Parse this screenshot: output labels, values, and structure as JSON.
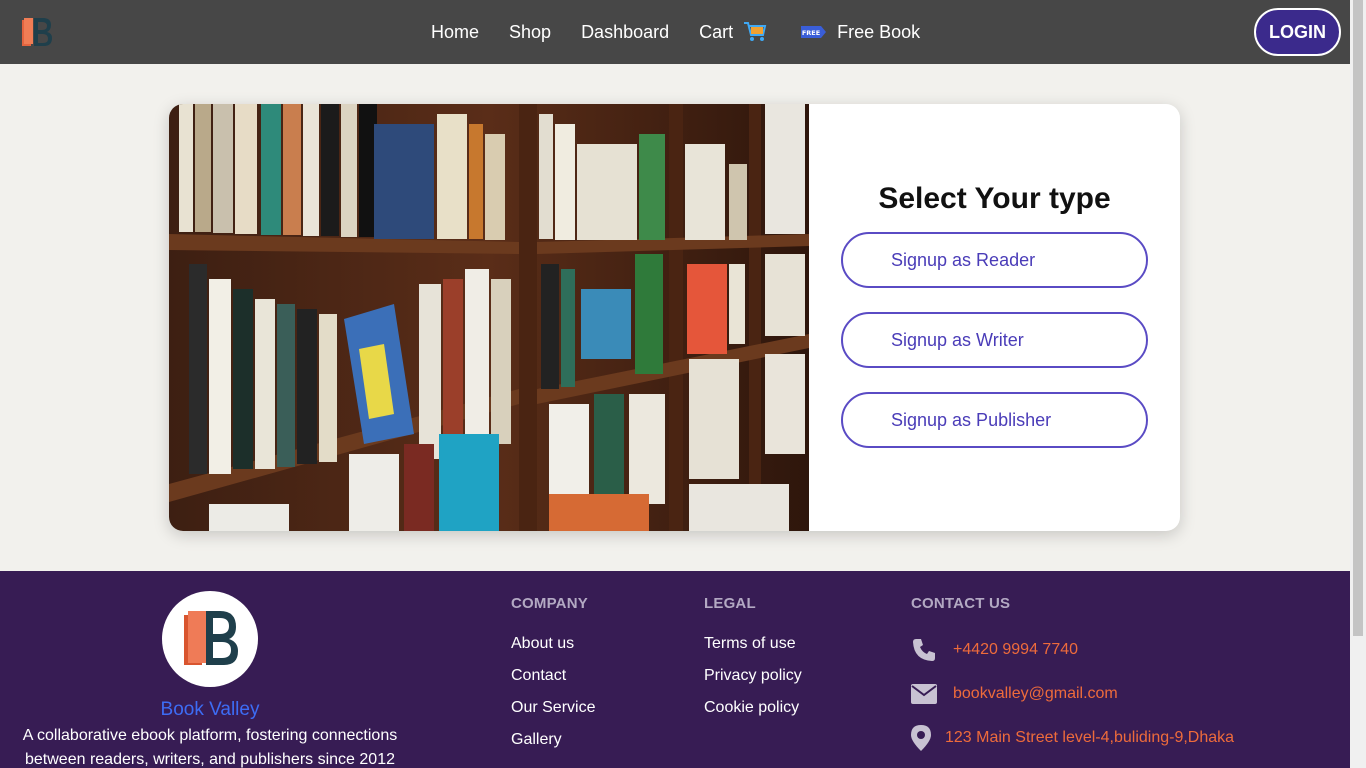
{
  "nav": {
    "links": [
      {
        "label": "Home"
      },
      {
        "label": "Shop"
      },
      {
        "label": "Dashboard"
      },
      {
        "label": "Cart"
      },
      {
        "label": "Free Book"
      }
    ],
    "free_badge": "FREE",
    "login_label": "LOGIN"
  },
  "signup": {
    "title": "Select Your type",
    "reader_label": "Signup as Reader",
    "writer_label": "Signup as Writer",
    "publisher_label": "Signup as Publisher"
  },
  "footer": {
    "brand": "Book Valley",
    "description_line1": "A collaborative ebook platform, fostering connections",
    "description_line2": "between readers, writers, and publishers since 2012",
    "company": {
      "heading": "COMPANY",
      "links": [
        "About us",
        "Contact",
        "Our Service",
        "Gallery"
      ]
    },
    "legal": {
      "heading": "LEGAL",
      "links": [
        "Terms of use",
        "Privacy policy",
        "Cookie policy"
      ]
    },
    "contact": {
      "heading": "CONTACT US",
      "phone": "+4420 9994 7740",
      "email": "bookvalley@gmail.com",
      "address": "123 Main Street level-4,buliding-9,Dhaka"
    }
  },
  "colors": {
    "navbar": "#474747",
    "accent": "#3b2a8c",
    "footer": "#371c54",
    "contact_text": "#ee6b3b",
    "brand_blue": "#3d6cf5"
  },
  "icons": {
    "cart": "cart-icon",
    "free_book": "free-tag-icon",
    "phone": "phone-icon",
    "email": "envelope-icon",
    "address": "location-pin-icon"
  }
}
